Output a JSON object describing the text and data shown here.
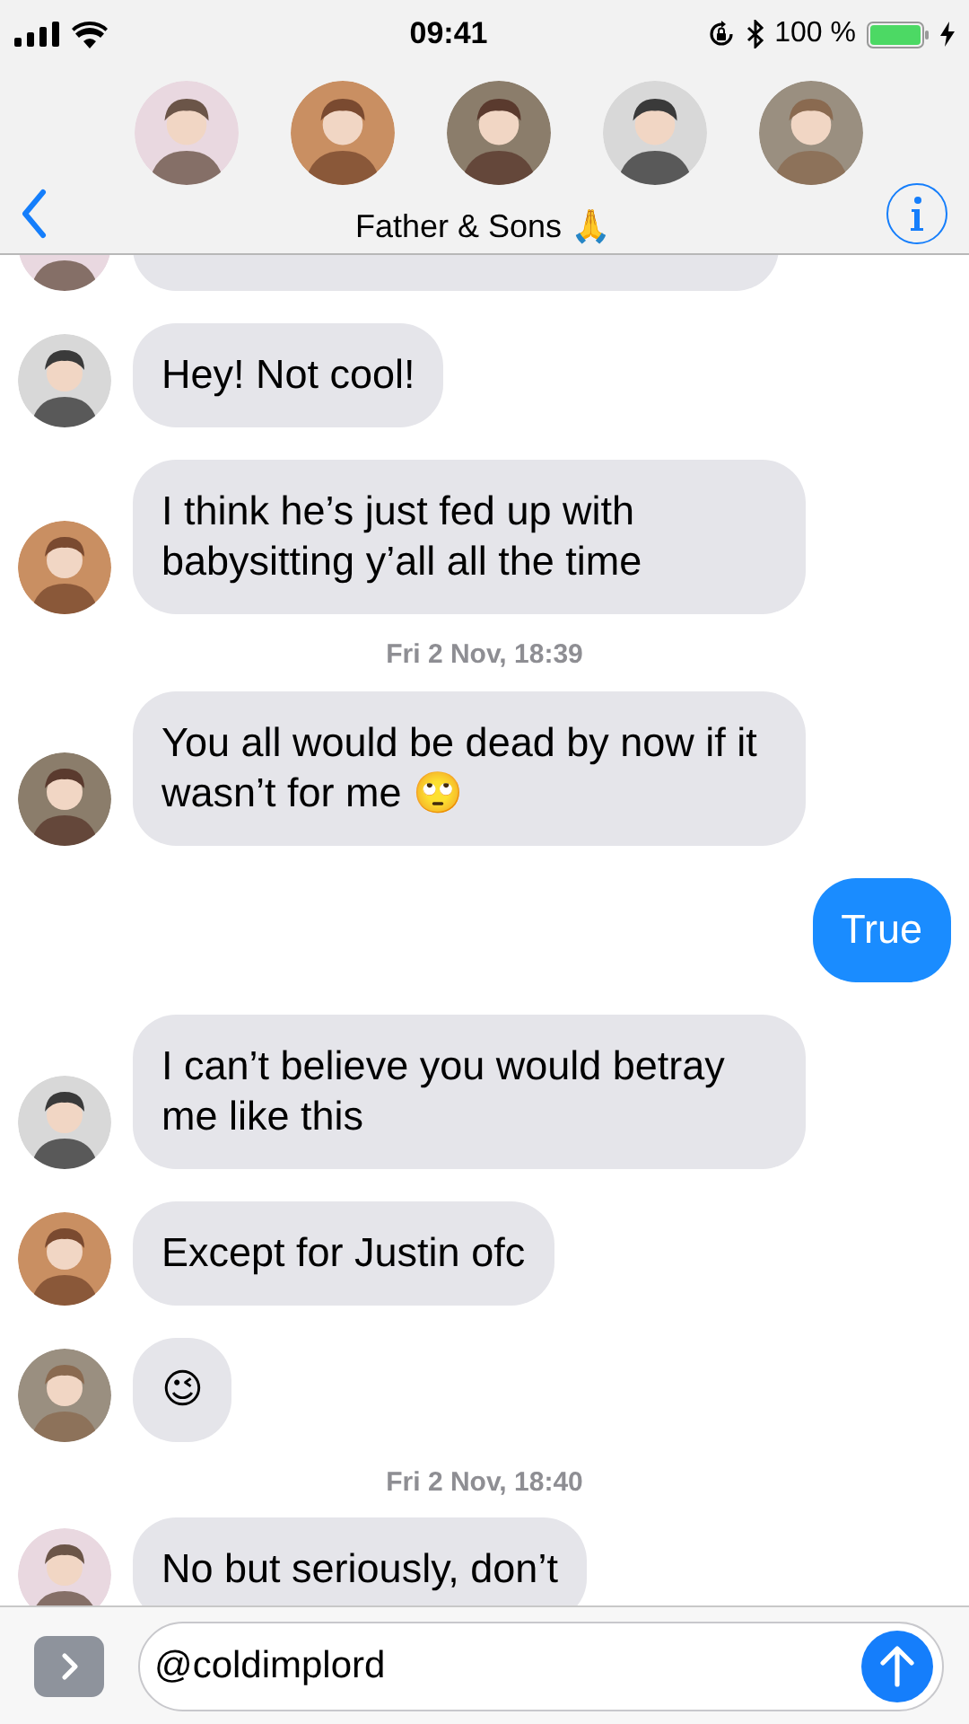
{
  "status_bar": {
    "time": "09:41",
    "battery": "100 %"
  },
  "header": {
    "title": "Father & Sons 🙏"
  },
  "messages": [
    {
      "kind": "clipped"
    },
    {
      "kind": "incoming",
      "text": "Hey! Not cool!"
    },
    {
      "kind": "incoming",
      "text": "I think he’s just fed up with babysitting y’all all the time"
    },
    {
      "kind": "timestamp",
      "text": "Fri 2 Nov, 18:39"
    },
    {
      "kind": "incoming",
      "text": "You all would be dead by now if it wasn’t for me 🙄"
    },
    {
      "kind": "outgoing",
      "text": "True"
    },
    {
      "kind": "incoming",
      "text": "I can’t believe you would betray me like this"
    },
    {
      "kind": "incoming",
      "text": "Except for Justin ofc"
    },
    {
      "kind": "incoming",
      "text": "😉"
    },
    {
      "kind": "timestamp",
      "text": "Fri 2 Nov, 18:40"
    },
    {
      "kind": "incoming",
      "text": "No but seriously, don’t"
    }
  ],
  "composer": {
    "value": "@coldimplord"
  }
}
